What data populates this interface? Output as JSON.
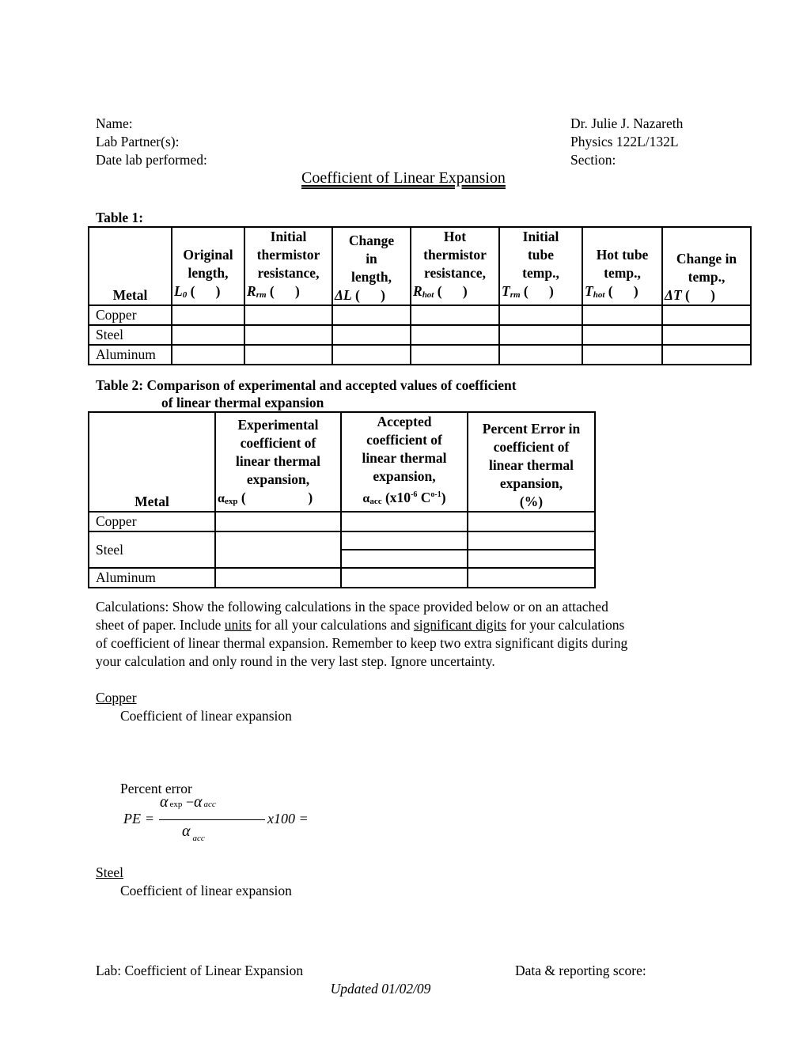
{
  "header": {
    "name_label": "Name:",
    "lab_partners_label": "Lab Partner(s):",
    "date_label": "Date lab performed:",
    "instructor": "Dr. Julie J. Nazareth",
    "course": "Physics 122L/132L",
    "section_label": "Section:",
    "title": "Coefficient of Linear Expansion"
  },
  "table1": {
    "caption": "Table 1:",
    "headers": [
      {
        "lines": [
          "",
          "",
          "",
          "Metal"
        ]
      },
      {
        "lines": [
          "",
          "Original",
          "length,"
        ],
        "symbol": "L",
        "sub": "0",
        "unit": "(      )"
      },
      {
        "lines": [
          "Initial",
          "thermistor",
          "resistance,"
        ],
        "symbol": "R",
        "sub": "rm",
        "unit": "(      )"
      },
      {
        "lines": [
          "Change",
          "in",
          "length,"
        ],
        "symbol": "ΔL",
        "sub": "",
        "unit": "(      )"
      },
      {
        "lines": [
          "Hot",
          "thermistor",
          "resistance,"
        ],
        "symbol": "R",
        "sub": "hot",
        "unit": "(      )"
      },
      {
        "lines": [
          "Initial",
          "tube",
          "temp.,"
        ],
        "symbol": "T",
        "sub": "rm",
        "unit": "(      )"
      },
      {
        "lines": [
          "",
          "Hot tube",
          "temp.,"
        ],
        "symbol": "T",
        "sub": "hot",
        "unit": "(      )"
      },
      {
        "lines": [
          "",
          "Change in",
          "temp.,"
        ],
        "symbol": "ΔT",
        "sub": "",
        "unit": "(      )"
      }
    ],
    "rows": [
      {
        "metal": "Copper",
        "cells": [
          "",
          "",
          "",
          "",
          "",
          "",
          ""
        ]
      },
      {
        "metal": "Steel",
        "cells": [
          "",
          "",
          "",
          "",
          "",
          "",
          ""
        ]
      },
      {
        "metal": "Aluminum",
        "cells": [
          "",
          "",
          "",
          "",
          "",
          "",
          ""
        ]
      }
    ]
  },
  "table2": {
    "caption_line1": "Table 2:  Comparison of experimental and accepted values of coefficient",
    "caption_line2": "of linear thermal expansion",
    "headers": [
      {
        "lines": [
          "Metal"
        ]
      },
      {
        "lines": [
          "Experimental",
          "coefficient of",
          "linear thermal",
          "expansion,"
        ],
        "symbol": "α",
        "sub": "exp",
        "unit": "(                  )"
      },
      {
        "lines": [
          "Accepted",
          "coefficient of",
          "linear thermal",
          "expansion,"
        ],
        "symbol": "α",
        "sub": "acc",
        "unit_prefix": "(x10",
        "unit_sup1": "-6",
        "unit_mid": " C",
        "unit_sup2": "o-1",
        "unit_suffix": ")"
      },
      {
        "lines": [
          "Percent Error in",
          "coefficient of",
          "linear thermal",
          "expansion,",
          "(%)"
        ]
      }
    ],
    "rows": [
      {
        "metal": "Copper"
      },
      {
        "metal": "Steel"
      },
      {
        "metal": "Aluminum"
      }
    ]
  },
  "calculations": {
    "intro_1": "Calculations:  Show the following calculations in the space provided below or on an attached",
    "intro_2a": "sheet of paper.  Include ",
    "intro_2_units": "units",
    "intro_2b": " for all your calculations and ",
    "intro_2_sig": "significant digits",
    "intro_2c": " for your calculations",
    "intro_3": "of coefficient of linear thermal expansion.  Remember to keep two extra significant digits during",
    "intro_4": "your calculation and only round in the very last step.  Ignore uncertainty.",
    "copper_heading": "Copper",
    "copper_coef_label": "Coefficient of linear expansion",
    "percent_error_label": "Percent error",
    "formula": {
      "lhs": "PE",
      "eq": "=",
      "num_alpha1": "α",
      "num_sub1": "exp",
      "minus": "−",
      "num_alpha2": "α",
      "num_sub2": "acc",
      "den_alpha": "α",
      "den_sub": "acc",
      "mult": "x100 ="
    },
    "steel_heading": "Steel",
    "steel_coef_label": "Coefficient of linear expansion"
  },
  "footer": {
    "left": "Lab:  Coefficient of Linear Expansion",
    "right": "Data & reporting score:",
    "updated": "Updated 01/02/09"
  }
}
